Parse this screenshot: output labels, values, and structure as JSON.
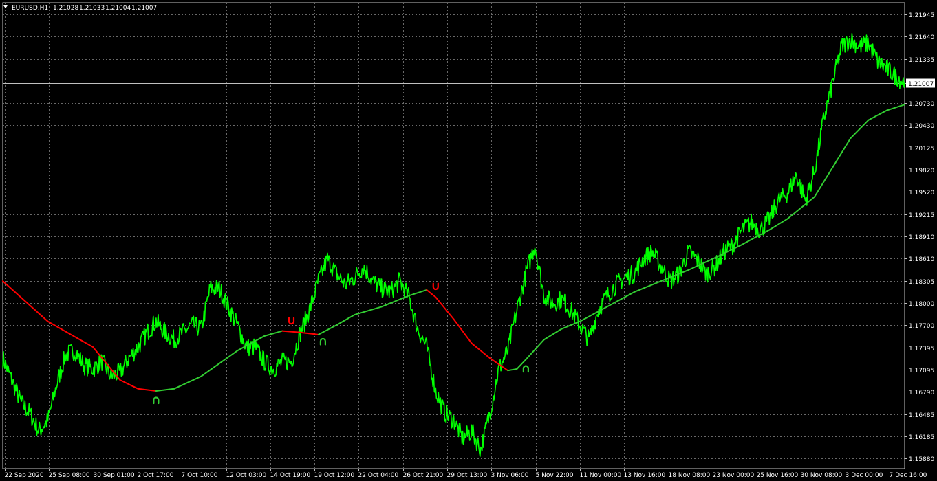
{
  "header": {
    "symbol": "EURUSD,H1",
    "open": "1.21028",
    "high": "1.21033",
    "low": "1.21004",
    "close": "1.21007"
  },
  "colors": {
    "background": "#000000",
    "grid": "#c0c0c0",
    "price": "#00ff00",
    "ma_up": "#32cd32",
    "ma_down": "#ff0000",
    "current_line": "#c0c0c0",
    "text": "#ffffff"
  },
  "chart_data": {
    "type": "line",
    "title": "",
    "xlabel": "",
    "ylabel": "",
    "grid": true,
    "ylim": [
      1.1574,
      1.221
    ],
    "y_ticks": [
      "1.21945",
      "1.21640",
      "1.21335",
      "1.21007",
      "1.20730",
      "1.20430",
      "1.20125",
      "1.19820",
      "1.19520",
      "1.19215",
      "1.18910",
      "1.18610",
      "1.18305",
      "1.18000",
      "1.17700",
      "1.17395",
      "1.17095",
      "1.16790",
      "1.16485",
      "1.16185",
      "1.15880"
    ],
    "x_ticks": [
      "22 Sep 2020",
      "25 Sep 08:00",
      "30 Sep 01:00",
      "2 Oct 17:00",
      "7 Oct 10:00",
      "12 Oct 03:00",
      "14 Oct 19:00",
      "19 Oct 12:00",
      "22 Oct 04:00",
      "26 Oct 21:00",
      "29 Oct 13:00",
      "3 Nov 06:00",
      "5 Nov 22:00",
      "11 Nov 00:00",
      "13 Nov 16:00",
      "18 Nov 08:00",
      "23 Nov 00:00",
      "25 Nov 16:00",
      "30 Nov 08:00",
      "3 Dec 00:00",
      "7 Dec 16:00"
    ],
    "current_price": "1.21007",
    "x_range": [
      0,
      100
    ],
    "series": [
      {
        "kind": "price",
        "x": [
          0,
          1,
          2,
          3,
          4,
          5,
          6,
          7,
          8,
          9,
          10,
          11,
          12,
          13,
          14,
          15,
          16,
          17,
          18,
          19,
          20,
          21,
          22,
          23,
          24,
          25,
          26,
          27,
          28,
          29,
          30,
          31,
          32,
          33,
          34,
          35,
          36,
          37,
          38,
          39,
          40,
          41,
          42,
          43,
          44,
          45,
          46,
          47,
          48,
          49,
          50,
          51,
          52,
          53,
          54,
          55,
          56,
          57,
          58,
          59,
          60,
          61,
          62,
          63,
          64,
          65,
          66,
          67,
          68,
          69,
          70,
          71,
          72,
          73,
          74,
          75,
          76,
          77,
          78,
          79,
          80,
          81,
          82,
          83,
          84,
          85,
          86,
          87,
          88,
          89,
          90,
          91,
          92,
          93,
          94,
          95,
          96,
          97,
          98,
          99,
          100
        ],
        "y": [
          1.1725,
          1.1695,
          1.1665,
          1.165,
          1.1625,
          1.164,
          1.169,
          1.173,
          1.1735,
          1.1715,
          1.171,
          1.172,
          1.17,
          1.1705,
          1.1725,
          1.174,
          1.176,
          1.1775,
          1.176,
          1.175,
          1.176,
          1.177,
          1.1765,
          1.182,
          1.182,
          1.1795,
          1.177,
          1.174,
          1.174,
          1.172,
          1.171,
          1.172,
          1.172,
          1.176,
          1.179,
          1.183,
          1.186,
          1.184,
          1.1825,
          1.1835,
          1.185,
          1.183,
          1.182,
          1.1815,
          1.183,
          1.181,
          1.1765,
          1.174,
          1.168,
          1.165,
          1.164,
          1.1615,
          1.1625,
          1.16,
          1.165,
          1.171,
          1.1735,
          1.179,
          1.184,
          1.188,
          1.181,
          1.18,
          1.1805,
          1.179,
          1.177,
          1.175,
          1.179,
          1.181,
          1.1825,
          1.1835,
          1.184,
          1.186,
          1.187,
          1.185,
          1.183,
          1.184,
          1.187,
          1.186,
          1.184,
          1.185,
          1.187,
          1.188,
          1.19,
          1.191,
          1.19,
          1.1915,
          1.194,
          1.195,
          1.1975,
          1.194,
          1.198,
          1.205,
          1.21,
          1.215,
          1.216,
          1.215,
          1.2155,
          1.213,
          1.212,
          1.211,
          1.2101
        ]
      },
      {
        "kind": "ma",
        "x": [
          0,
          5,
          10,
          13,
          15,
          17,
          19,
          22,
          26,
          29,
          31,
          33,
          35,
          37,
          39,
          42,
          45,
          47,
          48,
          50,
          52,
          54,
          56,
          57,
          58,
          60,
          62,
          64,
          67,
          70,
          73,
          76,
          79,
          82,
          85,
          87,
          90,
          92,
          94,
          96,
          98,
          100
        ],
        "y": [
          1.183,
          1.1775,
          1.174,
          1.1695,
          1.1683,
          1.168,
          1.1683,
          1.17,
          1.1735,
          1.1755,
          1.1762,
          1.176,
          1.1757,
          1.177,
          1.1784,
          1.1795,
          1.181,
          1.1818,
          1.1808,
          1.1778,
          1.1745,
          1.1725,
          1.1708,
          1.171,
          1.1723,
          1.175,
          1.1765,
          1.1775,
          1.1795,
          1.1815,
          1.183,
          1.1845,
          1.1862,
          1.188,
          1.19,
          1.1915,
          1.1945,
          1.1985,
          1.2025,
          1.205,
          1.2063,
          1.2071
        ]
      }
    ],
    "signals": [
      {
        "x": 17,
        "direction": "up"
      },
      {
        "x": 32,
        "direction": "down"
      },
      {
        "x": 35.5,
        "direction": "up"
      },
      {
        "x": 48,
        "direction": "down"
      },
      {
        "x": 58,
        "direction": "up"
      }
    ]
  }
}
